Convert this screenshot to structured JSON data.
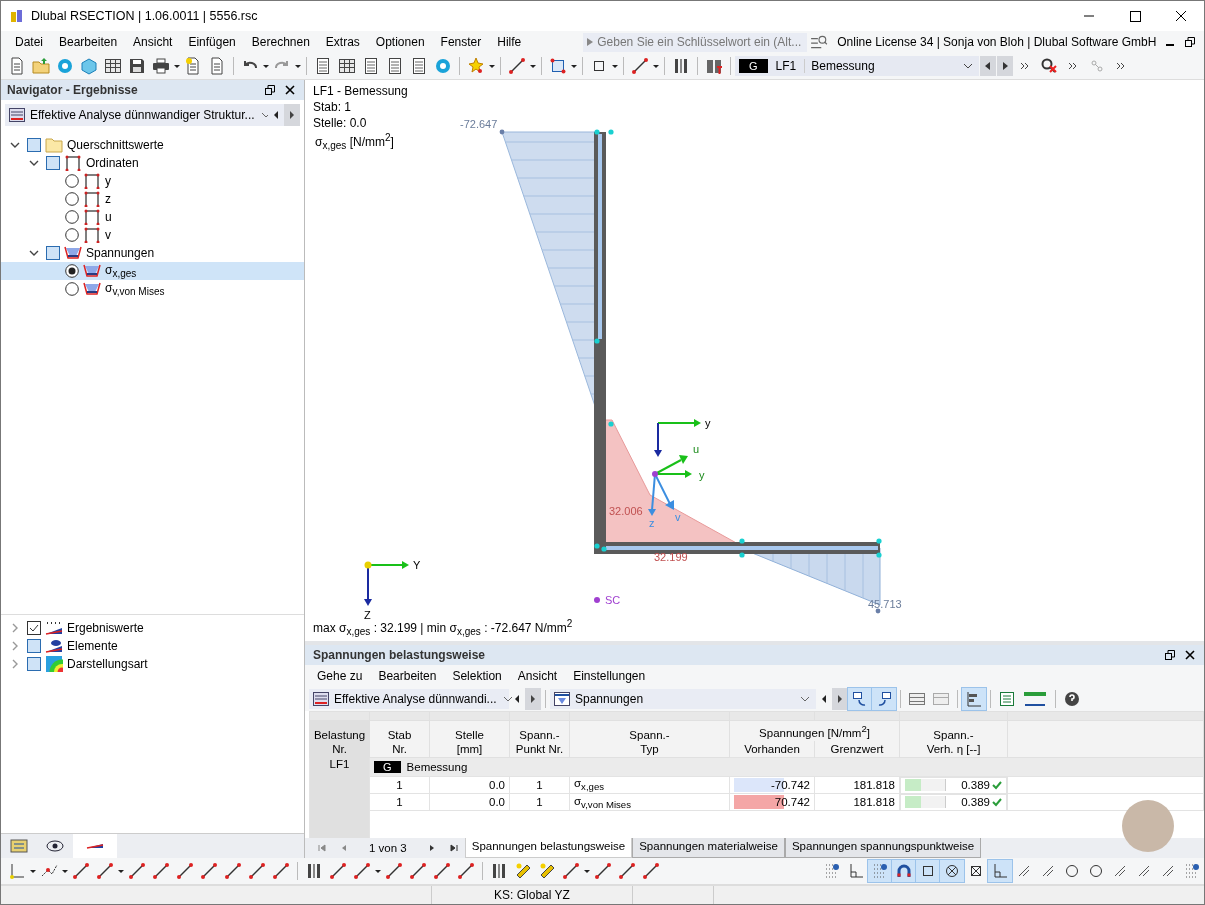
{
  "window": {
    "title": "Dlubal RSECTION | 1.06.0011 | 5556.rsc"
  },
  "menu": [
    "Datei",
    "Bearbeiten",
    "Ansicht",
    "Einfügen",
    "Berechnen",
    "Extras",
    "Optionen",
    "Fenster",
    "Hilfe"
  ],
  "search": {
    "placeholder": "Geben Sie ein Schlüsselwort ein (Alt..."
  },
  "license": "Online License 34 | Sonja von Bloh | Dlubal Software GmbH",
  "load_case": {
    "badge": "G",
    "id": "LF1",
    "name": "Bemessung"
  },
  "navigator": {
    "title": "Navigator - Ergebnisse",
    "module": "Effektive Analyse dünnwandiger Struktur...",
    "tree": [
      {
        "kind": "checkbox",
        "label": "Querschnittswerte",
        "checked": false,
        "expanded": true,
        "children": [
          {
            "kind": "checkbox",
            "label": "Ordinaten",
            "checked": false,
            "expanded": true,
            "children": [
              {
                "kind": "radio",
                "label": "y",
                "selected": false
              },
              {
                "kind": "radio",
                "label": "z",
                "selected": false
              },
              {
                "kind": "radio",
                "label": "u",
                "selected": false
              },
              {
                "kind": "radio",
                "label": "v",
                "selected": false
              }
            ]
          },
          {
            "kind": "checkbox",
            "label": "Spannungen",
            "checked": false,
            "expanded": true,
            "children": [
              {
                "kind": "radio",
                "label": "σ$_{x,ges}$",
                "selected": true
              },
              {
                "kind": "radio",
                "label": "σ$_{v,von Mises}$",
                "selected": false
              }
            ]
          }
        ]
      }
    ],
    "bottom_tree": [
      {
        "kind": "checkbox",
        "label": "Ergebniswerte",
        "checked": true,
        "expanded": false
      },
      {
        "kind": "checkbox",
        "label": "Elemente",
        "checked": false,
        "expanded": false
      },
      {
        "kind": "checkbox",
        "label": "Darstellungsart",
        "checked": false,
        "expanded": false
      }
    ],
    "tabs": [
      {
        "selected": false
      },
      {
        "selected": false
      },
      {
        "selected": true
      }
    ]
  },
  "view": {
    "title": "LF1 - Bemessung",
    "lines": [
      "Stab: 1",
      "Stelle: 0.0"
    ],
    "quantity": "σ$_{x,ges}$ [N/mm$^{2}$]",
    "values": [
      "-72.647",
      "32.006",
      "32.199",
      "45.713"
    ],
    "global_axes": [
      "Y",
      "Z"
    ],
    "local_axes": [
      "y",
      "u",
      "y",
      "v",
      "z"
    ],
    "shear_center": "SC",
    "summary": "max σ$_{x,ges}$ : 32.199 | min σ$_{x,ges}$ : -72.647 N/mm$^{2}$"
  },
  "results": {
    "title": "Spannungen belastungsweise",
    "menu": [
      "Gehe zu",
      "Bearbeiten",
      "Selektion",
      "Ansicht",
      "Einstellungen"
    ],
    "module": "Effektive Analyse dünnwandi...",
    "type": "Spannungen",
    "columns": [
      "Belastung\nNr.",
      "Stab\nNr.",
      "Stelle\n[mm]",
      "Spann.-\nPunkt Nr.",
      "Spann.-\nTyp",
      "Spannungen [N/mm$^{2}$]",
      "Vorhanden",
      "Grenzwert",
      "Spann.-\nVerh. η [--]"
    ],
    "group": {
      "case": "LF1",
      "badge": "G",
      "name": "Bemessung"
    },
    "rows": [
      {
        "stab": "1",
        "stelle": "0.0",
        "punkt": "1",
        "typ": "σ$_{x,ges}$",
        "vorhanden": "-70.742",
        "color": "#dce6fa",
        "grenzwert": "181.818",
        "ratio": "0.389",
        "level": 0.389,
        "ok": true
      },
      {
        "stab": "1",
        "stelle": "0.0",
        "punkt": "1",
        "typ": "σ$_{v,von Mises}$",
        "vorhanden": "70.742",
        "color": "#f4a6a6",
        "grenzwert": "181.818",
        "ratio": "0.389",
        "level": 0.389,
        "ok": true
      }
    ],
    "pager": "1 von 3",
    "tabs": [
      {
        "label": "Spannungen belastungsweise",
        "selected": true
      },
      {
        "label": "Spannungen materialweise",
        "selected": false
      },
      {
        "label": "Spannungen spannungspunktweise",
        "selected": false
      }
    ]
  },
  "status_bar": {
    "coordinate_system": "KS: Global YZ"
  }
}
